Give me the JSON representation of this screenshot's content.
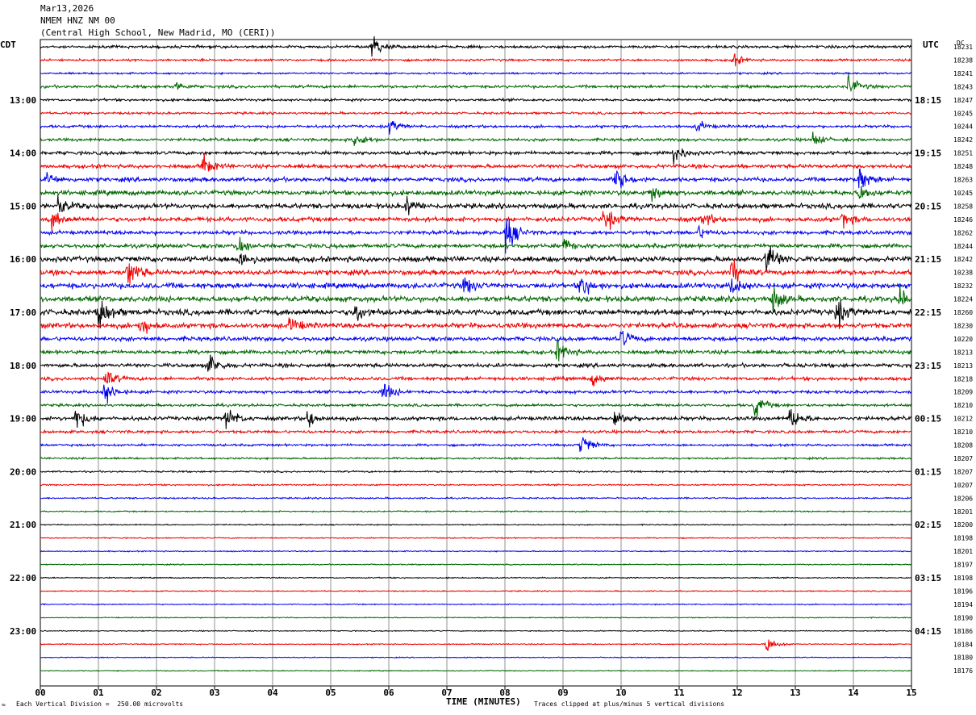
{
  "header": {
    "date": "Mar13,2026",
    "station": "NMEM HNZ NM 00",
    "location": "(Central High School, New Madrid, MO (CERI))"
  },
  "left_tz": "CDT",
  "right_tz": "UTC",
  "dc_label": "DC",
  "footer": {
    "scale": "Each Vertical Division =  250.00 microvolts",
    "clip": "Traces clipped at plus/minus 5 vertical divisions",
    "mark": "≈"
  },
  "chart_data": {
    "type": "line",
    "xlabel": "TIME (MINUTES)",
    "x_ticks": [
      "00",
      "01",
      "02",
      "03",
      "04",
      "05",
      "06",
      "07",
      "08",
      "09",
      "10",
      "11",
      "12",
      "13",
      "14",
      "15"
    ],
    "xlim": [
      0,
      15
    ],
    "trace_colors": [
      "#000000",
      "#ee0000",
      "#0000ee",
      "#006600"
    ],
    "left_hour_labels": [
      {
        "row": 4,
        "label": "13:00"
      },
      {
        "row": 8,
        "label": "14:00"
      },
      {
        "row": 12,
        "label": "15:00"
      },
      {
        "row": 16,
        "label": "16:00"
      },
      {
        "row": 20,
        "label": "17:00"
      },
      {
        "row": 24,
        "label": "18:00"
      },
      {
        "row": 28,
        "label": "19:00"
      },
      {
        "row": 32,
        "label": "20:00"
      },
      {
        "row": 36,
        "label": "21:00"
      },
      {
        "row": 40,
        "label": "22:00"
      },
      {
        "row": 44,
        "label": "23:00"
      }
    ],
    "right_hour_labels": [
      {
        "row": 4,
        "label": "18:15"
      },
      {
        "row": 8,
        "label": "19:15"
      },
      {
        "row": 12,
        "label": "20:15"
      },
      {
        "row": 16,
        "label": "21:15"
      },
      {
        "row": 20,
        "label": "22:15"
      },
      {
        "row": 24,
        "label": "23:15"
      },
      {
        "row": 28,
        "label": "00:15"
      },
      {
        "row": 32,
        "label": "01:15"
      },
      {
        "row": 36,
        "label": "02:15"
      },
      {
        "row": 40,
        "label": "03:15"
      },
      {
        "row": 44,
        "label": "04:15"
      }
    ],
    "dc_offsets": [
      18231,
      18238,
      18241,
      18243,
      18247,
      10245,
      10244,
      18242,
      18251,
      18248,
      18263,
      10245,
      18258,
      18246,
      18262,
      18244,
      18242,
      10238,
      18232,
      18224,
      18260,
      18230,
      10220,
      18213,
      18213,
      18218,
      18209,
      18210,
      10212,
      18210,
      18208,
      18207,
      18207,
      10207,
      18206,
      18201,
      18200,
      18198,
      18201,
      18197,
      18198,
      18196,
      18194,
      18190,
      18186,
      10184,
      18180,
      18176
    ],
    "row_activity": [
      1.4,
      1.2,
      1.0,
      1.5,
      1.3,
      1.2,
      1.4,
      1.5,
      1.8,
      2.0,
      2.2,
      2.5,
      2.6,
      2.4,
      2.0,
      2.2,
      2.8,
      2.6,
      2.8,
      2.9,
      3.0,
      2.6,
      2.2,
      2.0,
      2.0,
      1.8,
      1.6,
      1.4,
      2.0,
      1.5,
      1.2,
      1.0,
      0.9,
      0.8,
      0.8,
      0.7,
      0.6,
      0.6,
      0.6,
      0.6,
      0.6,
      0.6,
      0.6,
      0.5,
      0.5,
      0.6,
      0.5,
      0.5
    ],
    "events": [
      {
        "row": 0,
        "minute": 5.7,
        "amp": 14
      },
      {
        "row": 1,
        "minute": 11.9,
        "amp": 8
      },
      {
        "row": 3,
        "minute": 13.9,
        "amp": 12
      },
      {
        "row": 3,
        "minute": 2.3,
        "amp": 6
      },
      {
        "row": 6,
        "minute": 6.0,
        "amp": 8
      },
      {
        "row": 6,
        "minute": 11.3,
        "amp": 6
      },
      {
        "row": 7,
        "minute": 5.4,
        "amp": 10
      },
      {
        "row": 7,
        "minute": 13.3,
        "amp": 8
      },
      {
        "row": 8,
        "minute": 10.9,
        "amp": 12
      },
      {
        "row": 9,
        "minute": 2.8,
        "amp": 12
      },
      {
        "row": 10,
        "minute": 0.1,
        "amp": 8
      },
      {
        "row": 10,
        "minute": 9.9,
        "amp": 14
      },
      {
        "row": 10,
        "minute": 14.1,
        "amp": 14
      },
      {
        "row": 11,
        "minute": 10.5,
        "amp": 10
      },
      {
        "row": 11,
        "minute": 14.1,
        "amp": 8
      },
      {
        "row": 12,
        "minute": 0.3,
        "amp": 10
      },
      {
        "row": 12,
        "minute": 6.3,
        "amp": 10
      },
      {
        "row": 13,
        "minute": 0.2,
        "amp": 10
      },
      {
        "row": 13,
        "minute": 9.7,
        "amp": 14
      },
      {
        "row": 13,
        "minute": 11.4,
        "amp": 8
      },
      {
        "row": 13,
        "minute": 13.8,
        "amp": 8
      },
      {
        "row": 14,
        "minute": 8.0,
        "amp": 26
      },
      {
        "row": 14,
        "minute": 11.3,
        "amp": 8
      },
      {
        "row": 15,
        "minute": 3.4,
        "amp": 10
      },
      {
        "row": 15,
        "minute": 9.0,
        "amp": 8
      },
      {
        "row": 16,
        "minute": 3.4,
        "amp": 12
      },
      {
        "row": 16,
        "minute": 12.5,
        "amp": 20
      },
      {
        "row": 17,
        "minute": 1.5,
        "amp": 18
      },
      {
        "row": 17,
        "minute": 11.9,
        "amp": 14
      },
      {
        "row": 18,
        "minute": 7.3,
        "amp": 10
      },
      {
        "row": 18,
        "minute": 9.3,
        "amp": 14
      },
      {
        "row": 18,
        "minute": 11.9,
        "amp": 10
      },
      {
        "row": 19,
        "minute": 12.6,
        "amp": 14
      },
      {
        "row": 19,
        "minute": 14.8,
        "amp": 12
      },
      {
        "row": 20,
        "minute": 1.0,
        "amp": 22
      },
      {
        "row": 20,
        "minute": 5.4,
        "amp": 12
      },
      {
        "row": 20,
        "minute": 13.7,
        "amp": 16
      },
      {
        "row": 21,
        "minute": 1.7,
        "amp": 12
      },
      {
        "row": 21,
        "minute": 4.3,
        "amp": 10
      },
      {
        "row": 22,
        "minute": 10.0,
        "amp": 10
      },
      {
        "row": 23,
        "minute": 8.9,
        "amp": 12
      },
      {
        "row": 24,
        "minute": 2.9,
        "amp": 14
      },
      {
        "row": 25,
        "minute": 1.1,
        "amp": 12
      },
      {
        "row": 25,
        "minute": 9.5,
        "amp": 8
      },
      {
        "row": 26,
        "minute": 1.1,
        "amp": 14
      },
      {
        "row": 26,
        "minute": 5.9,
        "amp": 12
      },
      {
        "row": 27,
        "minute": 12.3,
        "amp": 14
      },
      {
        "row": 28,
        "minute": 0.6,
        "amp": 14
      },
      {
        "row": 28,
        "minute": 3.2,
        "amp": 14
      },
      {
        "row": 28,
        "minute": 4.6,
        "amp": 10
      },
      {
        "row": 28,
        "minute": 9.9,
        "amp": 12
      },
      {
        "row": 28,
        "minute": 12.9,
        "amp": 14
      },
      {
        "row": 30,
        "minute": 9.3,
        "amp": 14
      },
      {
        "row": 45,
        "minute": 12.5,
        "amp": 10
      }
    ]
  }
}
